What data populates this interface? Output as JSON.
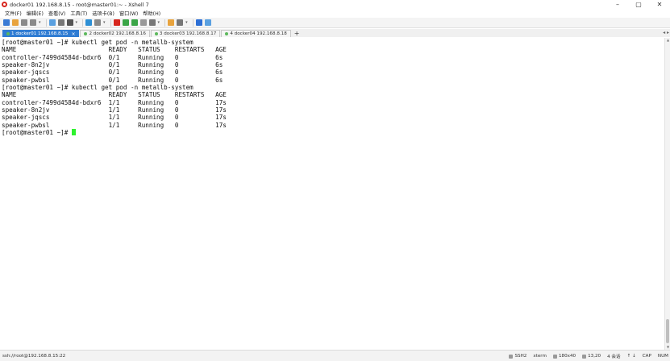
{
  "window": {
    "title": "docker01 192.168.8.15 - root@master01:~ - Xshell 7",
    "controls": {
      "minimize": "–",
      "maximize": "▢",
      "close": "✕"
    }
  },
  "menu": {
    "items": [
      "文件(F)",
      "编辑(E)",
      "查看(V)",
      "工具(T)",
      "选项卡(B)",
      "窗口(W)",
      "帮助(H)"
    ]
  },
  "toolbar": {
    "icons": [
      {
        "name": "new-session-icon",
        "color": "#3a7bd5"
      },
      {
        "name": "open-folder-icon",
        "color": "#e8a33d"
      },
      {
        "name": "link-icon",
        "color": "#8a8a8a"
      },
      {
        "name": "unlink-icon",
        "color": "#8a8a8a"
      },
      {
        "name": "properties-icon",
        "color": "#5aa0e0"
      },
      {
        "name": "search-icon",
        "color": "#777777"
      },
      {
        "name": "font-icon",
        "color": "#555555"
      },
      {
        "name": "globe-icon",
        "color": "#2d8fd5"
      },
      {
        "name": "script-icon",
        "color": "#8a8a8a"
      },
      {
        "name": "xftp-icon",
        "color": "#d7261e"
      },
      {
        "name": "transfer-icon",
        "color": "#3aa547"
      },
      {
        "name": "fullscreen-icon",
        "color": "#3aa547"
      },
      {
        "name": "lock-icon",
        "color": "#999999"
      },
      {
        "name": "keyboard-icon",
        "color": "#777777"
      },
      {
        "name": "compose-icon",
        "color": "#e8a33d"
      },
      {
        "name": "layout-icon",
        "color": "#777777"
      },
      {
        "name": "help-icon",
        "color": "#2d6fd5"
      },
      {
        "name": "chat-icon",
        "color": "#5aa0e0"
      }
    ]
  },
  "tabs": [
    {
      "label": "1 docker01 192.168.8.15",
      "active": true
    },
    {
      "label": "2 docker02 192.168.8.16",
      "active": false
    },
    {
      "label": "3 docker03 192.168.8.17",
      "active": false
    },
    {
      "label": "4 docker04 192.168.8.18",
      "active": false
    }
  ],
  "tab_add": "+",
  "tab_nav": "◂ ▸",
  "terminal": {
    "lines": [
      "[root@master01 ~]# kubectl get pod -n metallb-system",
      "NAME                         READY   STATUS    RESTARTS   AGE",
      "controller-7499d4584d-bdxr6  0/1     Running   0          6s",
      "speaker-8n2jv                0/1     Running   0          6s",
      "speaker-jqscs                0/1     Running   0          6s",
      "speaker-pwbsl                0/1     Running   0          6s",
      "[root@master01 ~]# kubectl get pod -n metallb-system",
      "NAME                         READY   STATUS    RESTARTS   AGE",
      "controller-7499d4584d-bdxr6  1/1     Running   0          17s",
      "speaker-8n2jv                1/1     Running   0          17s",
      "speaker-jqscs                1/1     Running   0          17s",
      "speaker-pwbsl                1/1     Running   0          17s"
    ],
    "prompt": "[root@master01 ~]# ",
    "cursor_color": "#2ef22e"
  },
  "status": {
    "connection": "ssh://root@192.168.8.15:22",
    "protocol": "SSH2",
    "terminal_type": "xterm",
    "size": "180x40",
    "position": "13,20",
    "sessions": "4 会话",
    "cap": "CAP",
    "num": "NUM"
  }
}
